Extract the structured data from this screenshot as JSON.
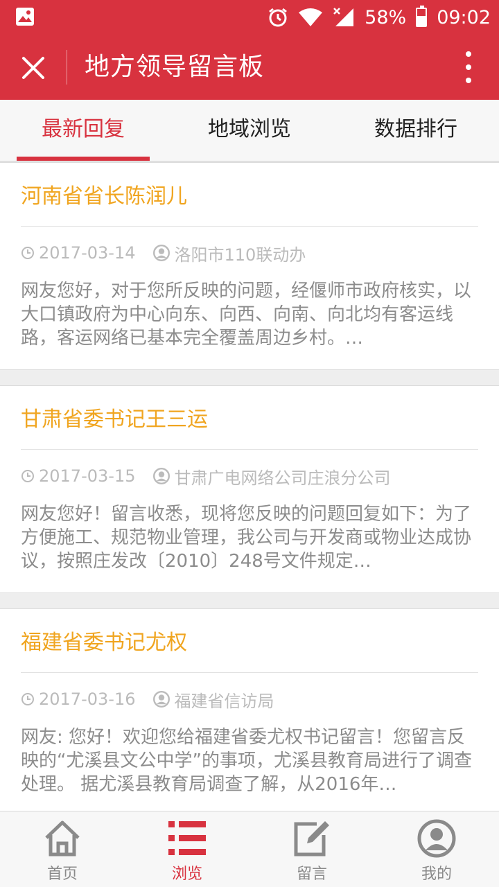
{
  "status": {
    "battery": "58%",
    "battery_level": 0.58,
    "time": "09:02"
  },
  "app": {
    "title": "地方领导留言板"
  },
  "tabs": [
    {
      "label": "最新回复",
      "active": true
    },
    {
      "label": "地域浏览",
      "active": false
    },
    {
      "label": "数据排行",
      "active": false
    }
  ],
  "posts": [
    {
      "title": "河南省省长陈润儿",
      "date": "2017-03-14",
      "department": "洛阳市110联动办",
      "summary": "网友您好，对于您所反映的问题，经偃师市政府核实，以大口镇政府为中心向东、向西、向南、向北均有客运线路，客运网络已基本完全覆盖周边乡村。…"
    },
    {
      "title": "甘肃省委书记王三运",
      "date": "2017-03-15",
      "department": "甘肃广电网络公司庄浪分公司",
      "summary": "网友您好！留言收悉，现将您反映的问题回复如下：为了方便施工、规范物业管理，我公司与开发商或物业达成协议，按照庄发改〔2010〕248号文件规定…"
    },
    {
      "title": "福建省委书记尤权",
      "date": "2017-03-16",
      "department": "福建省信访局",
      "summary": "网友: 您好！欢迎您给福建省委尤权书记留言！您留言反映的“尤溪县文公中学”的事项，尤溪县教育局进行了调查处理。 据尤溪县教育局调查了解，从2016年…"
    }
  ],
  "nav": [
    {
      "label": "首页",
      "icon": "home-icon",
      "active": false
    },
    {
      "label": "浏览",
      "icon": "list-icon",
      "active": true
    },
    {
      "label": "留言",
      "icon": "edit-icon",
      "active": false
    },
    {
      "label": "我的",
      "icon": "user-icon",
      "active": false
    }
  ],
  "colors": {
    "primary": "#d8323f",
    "title": "#f0a520",
    "meta": "#bbbbbb",
    "summary": "#8c8c8c"
  }
}
